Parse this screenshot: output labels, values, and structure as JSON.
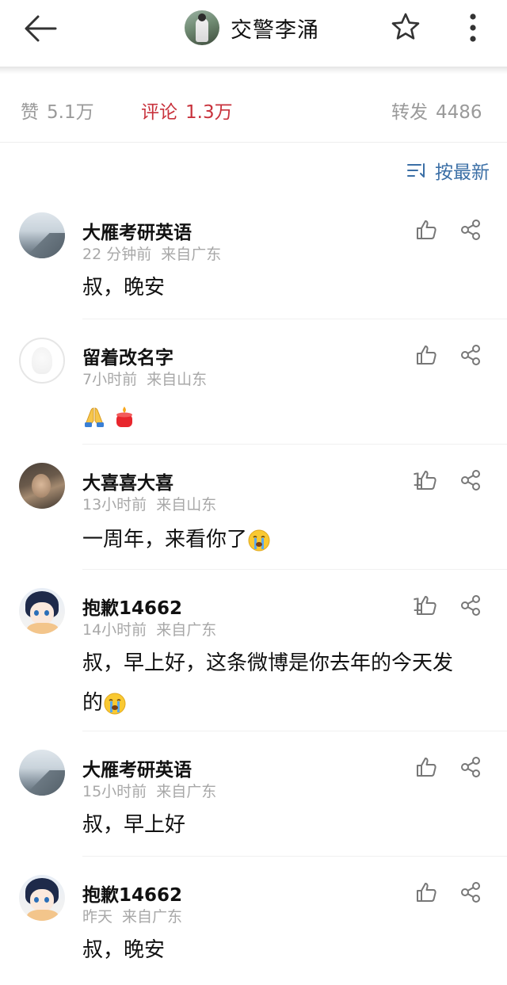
{
  "header": {
    "title": "交警李涌",
    "back_icon": "arrow-left-icon",
    "star_icon": "star-outline-icon",
    "more_icon": "more-vertical-icon"
  },
  "stats": {
    "likes_label": "赞",
    "likes_value": "5.1万",
    "comments_label": "评论",
    "comments_value": "1.3万",
    "reposts_label": "转发",
    "reposts_value": "4486",
    "active_color": "#c8323c"
  },
  "sort": {
    "label": "按最新",
    "icon": "sort-lines-icon",
    "color": "#3b6fa6"
  },
  "comments": [
    {
      "name": "大雁考研英语",
      "time": "22 分钟前",
      "location": "来自广东",
      "text": "叔，晚安",
      "likes": ""
    },
    {
      "name": "留着改名字",
      "time": "7小时前",
      "location": "来自山东",
      "text": "",
      "likes": "",
      "emojis": [
        "folded-hands-emoji",
        "candle-emoji"
      ]
    },
    {
      "name": "大喜喜大喜",
      "time": "13小时前",
      "location": "来自山东",
      "text": "一周年，来看你了",
      "likes": "1",
      "emojis": [
        "crying-face-emoji"
      ]
    },
    {
      "name": "抱歉14662",
      "time": "14小时前",
      "location": "来自广东",
      "text_line1": "叔，早上好，这条微博是你去年的今天发",
      "text_line2": "的",
      "likes": "1",
      "emojis": [
        "crying-face-emoji"
      ]
    },
    {
      "name": "大雁考研英语",
      "time": "15小时前",
      "location": "来自广东",
      "text": "叔，早上好",
      "likes": ""
    },
    {
      "name": "抱歉14662",
      "time": "昨天",
      "location": "来自广东",
      "text": "叔，晚安",
      "likes": ""
    }
  ]
}
